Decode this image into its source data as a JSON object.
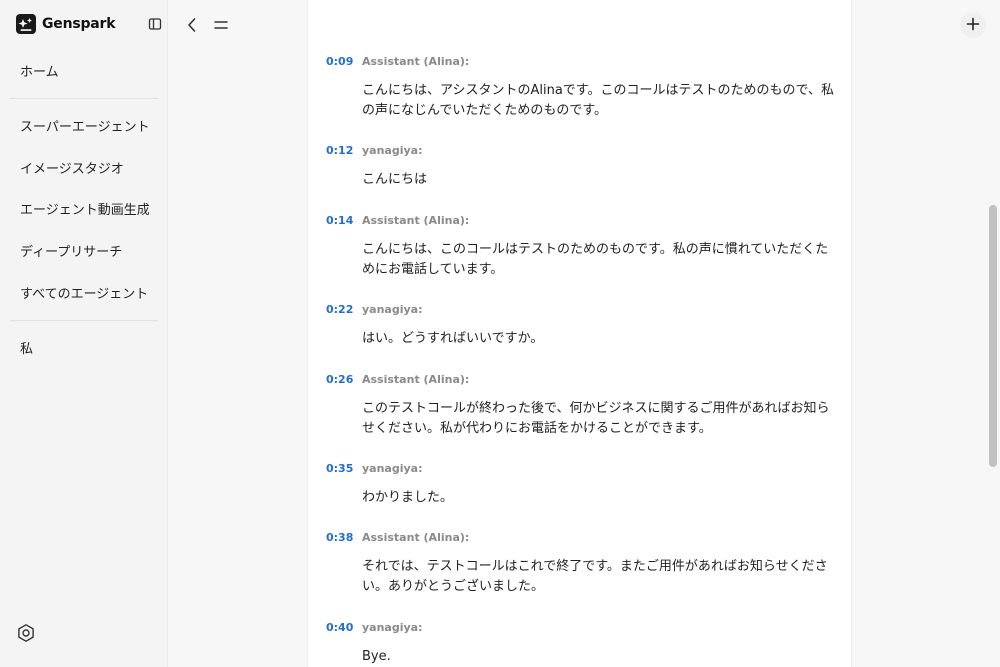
{
  "brand": {
    "name": "Genspark",
    "logo_icon": "genspark-logo-icon"
  },
  "sidebar": {
    "items": [
      {
        "label": "ホーム"
      },
      {
        "label": "スーパーエージェント"
      },
      {
        "label": "イメージスタジオ"
      },
      {
        "label": "エージェント動画生成"
      },
      {
        "label": "ディープリサーチ"
      },
      {
        "label": "すべてのエージェント"
      },
      {
        "label": "私"
      }
    ]
  },
  "transcript": [
    {
      "time": "0:09",
      "speaker": "Assistant (Alina):",
      "text": "こんにちは、アシスタントのAlinaです。このコールはテストのためのもので、私の声になじんでいただくためのものです。"
    },
    {
      "time": "0:12",
      "speaker": "yanagiya:",
      "text": "こんにちは"
    },
    {
      "time": "0:14",
      "speaker": "Assistant (Alina):",
      "text": "こんにちは、このコールはテストのためのものです。私の声に慣れていただくためにお電話しています。"
    },
    {
      "time": "0:22",
      "speaker": "yanagiya:",
      "text": "はい。どうすればいいですか。"
    },
    {
      "time": "0:26",
      "speaker": "Assistant (Alina):",
      "text": "このテストコールが終わった後で、何かビジネスに関するご用件があればお知らせください。私が代わりにお電話をかけることができます。"
    },
    {
      "time": "0:35",
      "speaker": "yanagiya:",
      "text": "わかりました。"
    },
    {
      "time": "0:38",
      "speaker": "Assistant (Alina):",
      "text": "それでは、テストコールはこれで終了です。またご用件があればお知らせください。ありがとうございました。"
    },
    {
      "time": "0:40",
      "speaker": "yanagiya:",
      "text": "Bye."
    }
  ],
  "colors": {
    "accent": "#1f6fd6",
    "speaker": "#8a8a8a",
    "sidebar_bg": "#f4f4f4"
  }
}
